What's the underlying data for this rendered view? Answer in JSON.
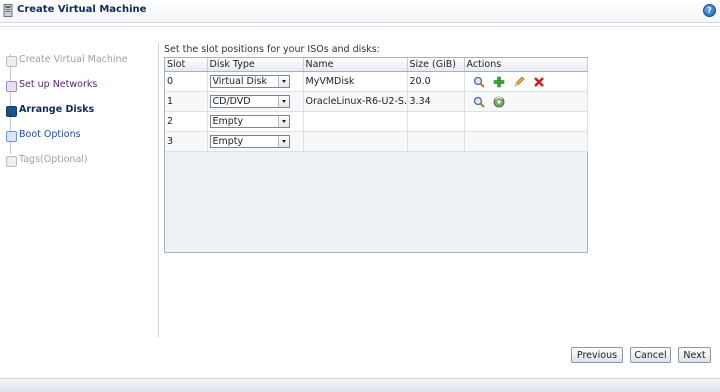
{
  "window": {
    "title": "Create Virtual Machine",
    "help_icon": "help-icon",
    "help_glyph": "?"
  },
  "train": {
    "steps": [
      {
        "label": "Create Virtual Machine",
        "state": "visited-disabled"
      },
      {
        "label": "Set up Networks",
        "state": "visited"
      },
      {
        "label": "Arrange Disks",
        "state": "current"
      },
      {
        "label": "Boot Options",
        "state": "next"
      },
      {
        "label": "Tags(Optional)",
        "state": "disabled"
      }
    ]
  },
  "main": {
    "instruction": "Set the slot positions for your ISOs and disks:",
    "table": {
      "columns": [
        "Slot",
        "Disk Type",
        "Name",
        "Size (GiB)",
        "Actions"
      ],
      "rows": [
        {
          "slot": "0",
          "disk_type": "Virtual Disk",
          "name": "MyVMDisk",
          "size": "20.0",
          "actions": [
            "search-icon",
            "add-icon",
            "edit-icon",
            "delete-icon"
          ]
        },
        {
          "slot": "1",
          "disk_type": "CD/DVD",
          "name": "OracleLinux-R6-U2-S...",
          "size": "3.34",
          "actions": [
            "search-icon",
            "refresh-disk-icon"
          ]
        },
        {
          "slot": "2",
          "disk_type": "Empty",
          "name": "",
          "size": "",
          "actions": []
        },
        {
          "slot": "3",
          "disk_type": "Empty",
          "name": "",
          "size": "",
          "actions": []
        }
      ]
    }
  },
  "buttons": {
    "previous": "Previous",
    "cancel": "Cancel",
    "next": "Next"
  },
  "colors": {
    "current_step": "#1f4f8c",
    "visited_step": "#5b1e6d",
    "next_step": "#1c4d9a"
  }
}
